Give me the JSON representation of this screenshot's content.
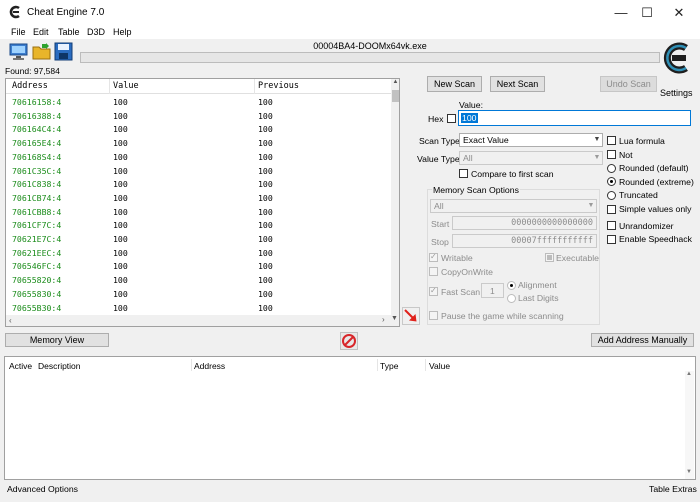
{
  "window": {
    "title": "Cheat Engine 7.0",
    "controls": [
      "—",
      "☐",
      "✕"
    ]
  },
  "menu": [
    "File",
    "Edit",
    "Table",
    "D3D",
    "Help"
  ],
  "process": {
    "name": "00004BA4-DOOMx64vk.exe"
  },
  "found_label": "Found: 97,584",
  "settings_label": "Settings",
  "results": {
    "columns": [
      "Address",
      "Value",
      "Previous"
    ],
    "rows": [
      {
        "address": "70616158:4",
        "value": "100",
        "previous": "100"
      },
      {
        "address": "70616388:4",
        "value": "100",
        "previous": "100"
      },
      {
        "address": "706164C4:4",
        "value": "100",
        "previous": "100"
      },
      {
        "address": "706165E4:4",
        "value": "100",
        "previous": "100"
      },
      {
        "address": "706168S4:4",
        "value": "100",
        "previous": "100"
      },
      {
        "address": "7061C35C:4",
        "value": "100",
        "previous": "100"
      },
      {
        "address": "7061C838:4",
        "value": "100",
        "previous": "100"
      },
      {
        "address": "7061CB74:4",
        "value": "100",
        "previous": "100"
      },
      {
        "address": "7061CBB8:4",
        "value": "100",
        "previous": "100"
      },
      {
        "address": "7061CF7C:4",
        "value": "100",
        "previous": "100"
      },
      {
        "address": "70621E7C:4",
        "value": "100",
        "previous": "100"
      },
      {
        "address": "70621EEC:4",
        "value": "100",
        "previous": "100"
      },
      {
        "address": "706546FC:4",
        "value": "100",
        "previous": "100"
      },
      {
        "address": "70655820:4",
        "value": "100",
        "previous": "100"
      },
      {
        "address": "70655830:4",
        "value": "100",
        "previous": "100"
      },
      {
        "address": "70655B30:4",
        "value": "100",
        "previous": "100"
      }
    ]
  },
  "scan": {
    "new_scan": "New Scan",
    "next_scan": "Next Scan",
    "undo_scan": "Undo Scan",
    "value_label": "Value:",
    "hex_label": "Hex",
    "value": "100",
    "scan_type_label": "Scan Type",
    "scan_type": "Exact Value",
    "value_type_label": "Value Type",
    "value_type": "All",
    "compare_first": "Compare to first scan",
    "memory_options_label": "Memory Scan Options",
    "region": "All",
    "start_label": "Start",
    "start_value": "0000000000000000",
    "stop_label": "Stop",
    "stop_value": "00007fffffffffff",
    "writable": "Writable",
    "executable": "Executable",
    "copy_on_write": "CopyOnWrite",
    "fast_scan": "Fast Scan",
    "fast_scan_value": "1",
    "alignment": "Alignment",
    "last_digits": "Last Digits",
    "pause_game": "Pause the game while scanning"
  },
  "options": {
    "lua_formula": "Lua formula",
    "not": "Not",
    "rounded_default": "Rounded (default)",
    "rounded_extreme": "Rounded (extreme)",
    "truncated": "Truncated",
    "simple_values": "Simple values only",
    "unrandomizer": "Unrandomizer",
    "speedhack": "Enable Speedhack"
  },
  "memory_view_button": "Memory View",
  "add_address_button": "Add Address Manually",
  "address_table": {
    "columns": [
      "Active",
      "Description",
      "Address",
      "Type",
      "Value"
    ]
  },
  "bottom": {
    "advanced_options": "Advanced Options",
    "table_extras": "Table Extras"
  },
  "colors": {
    "address_green": "#1a8c1a",
    "highlight_blue": "#0078d7"
  }
}
